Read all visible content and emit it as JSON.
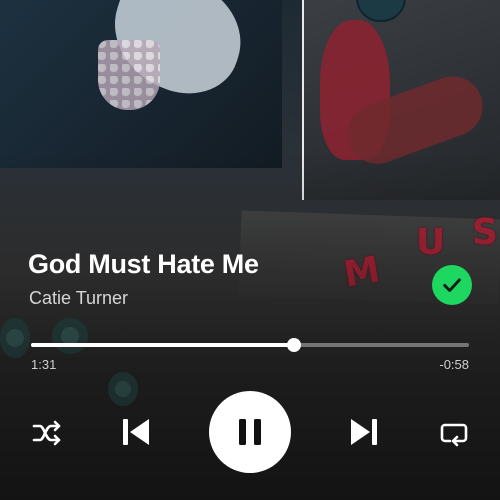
{
  "track": {
    "title": "God Must Hate Me",
    "artist": "Catie Turner",
    "liked": true
  },
  "playback": {
    "elapsed": "1:31",
    "remaining": "-0:58",
    "progress_fraction": 0.6,
    "state": "playing"
  },
  "controls": {
    "shuffle_icon": "shuffle-icon",
    "previous_icon": "skip-previous-icon",
    "play_pause_icon": "pause-icon",
    "next_icon": "skip-next-icon",
    "repeat_icon": "repeat-icon"
  },
  "colors": {
    "accent": "#1ed760",
    "text_primary": "#ffffff",
    "text_secondary": "#d6d6d6"
  }
}
